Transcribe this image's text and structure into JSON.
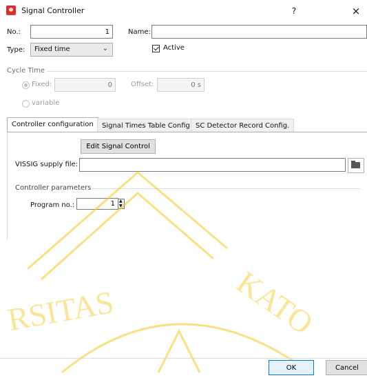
{
  "window": {
    "title": "Signal Controller",
    "help_label": "?",
    "close_label": "×"
  },
  "form": {
    "no_label": "No.:",
    "no_value": "1",
    "name_label": "Name:",
    "name_value": "",
    "type_label": "Type:",
    "type_value": "Fixed time",
    "active_label": "Active",
    "active_checked": true
  },
  "cycle_time": {
    "group_label": "Cycle Time",
    "fixed_label": "Fixed:",
    "fixed_value": "0",
    "offset_label": "Offset:",
    "offset_value": "0 s",
    "variable_label": "variable"
  },
  "tabs": [
    {
      "label": "Controller configuration",
      "active": true
    },
    {
      "label": "Signal Times Table Config.",
      "active": false
    },
    {
      "label": "SC Detector Record Config.",
      "active": false
    }
  ],
  "controller_config": {
    "edit_button_label": "Edit Signal Control",
    "vissig_label": "VISSIG supply file:",
    "vissig_value": "",
    "params_group_label": "Controller parameters",
    "program_label": "Program no.:",
    "program_value": "1"
  },
  "footer": {
    "ok_label": "OK",
    "cancel_label": "Cancel"
  },
  "watermark": {
    "text_left": "RSITAS",
    "text_right": "KATO"
  },
  "colors": {
    "app_icon": "#e02b2b",
    "accent_border": "#0078d7",
    "watermark": "#f5c518"
  }
}
